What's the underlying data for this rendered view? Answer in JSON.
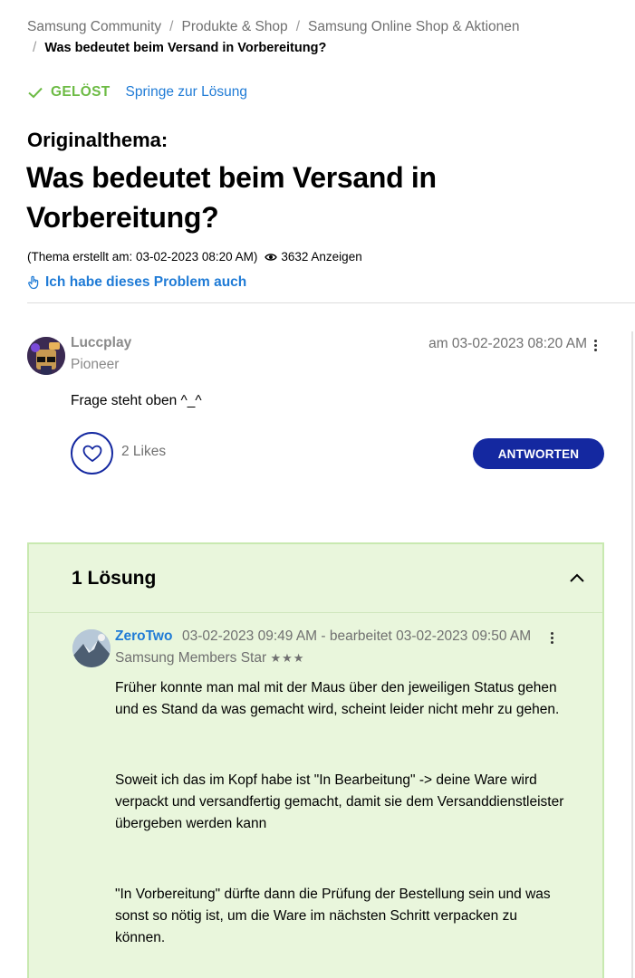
{
  "breadcrumb": {
    "items": [
      "Samsung Community",
      "Produkte & Shop",
      "Samsung Online Shop & Aktionen"
    ],
    "separator": "/",
    "current": "Was bedeutet beim Versand in Vorbereitung?"
  },
  "status": {
    "solved_label": "GELÖST",
    "jump_link": "Springe zur Lösung",
    "solved_color": "#6dbb45",
    "link_color": "#1f7bd6"
  },
  "topic": {
    "label": "Originalthema:",
    "title": "Was bedeutet beim Versand in Vorbereitung?",
    "created": "(Thema erstellt am: 03-02-2023 08:20 AM)",
    "views": "3632 Anzeigen",
    "problem_too": "Ich habe dieses Problem auch"
  },
  "original_post": {
    "author": "Luccplay",
    "rank": "Pioneer",
    "date": "am 03-02-2023 08:20 AM",
    "body": "Frage steht oben ^_^",
    "likes": "2 Likes",
    "reply_label": "ANTWORTEN",
    "accent_color": "#1428a0"
  },
  "solution": {
    "title": "1 Lösung",
    "author": "ZeroTwo",
    "date": "03-02-2023 09:49 AM - bearbeitet 03-02-2023 09:50 AM",
    "rank": "Samsung Members Star",
    "rank_stars": "★★★",
    "paragraphs": [
      "Früher konnte man mal mit der Maus über den jeweiligen Status gehen und es Stand da was gemacht wird, scheint leider nicht mehr zu gehen.",
      "Soweit ich das im Kopf habe ist \"In Bearbeitung\" -> deine Ware wird verpackt und versandfertig gemacht, damit sie dem Versanddienstleister übergeben werden kann",
      "\"In Vorbereitung\" dürfte dann die Prüfung der Bestellung sein und was sonst so nötig ist, um die Ware im nächsten Schritt verpacken zu können."
    ],
    "background_color": "#e9f6dc"
  },
  "icons": [
    "check-icon",
    "eye-icon",
    "hand-icon",
    "kebab-menu-icon",
    "heart-icon",
    "chevron-up-icon"
  ]
}
